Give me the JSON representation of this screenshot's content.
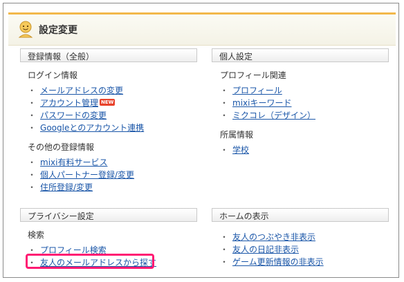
{
  "header": {
    "title": "設定変更"
  },
  "left_top": {
    "heading": "登録情報（全般）",
    "group1": {
      "title": "ログイン情報",
      "items": [
        "メールアドレスの変更",
        "アカウント管理",
        "パスワードの変更",
        "Googleとのアカウント連携"
      ],
      "new_badge": "NEW"
    },
    "group2": {
      "title": "その他の登録情報",
      "items": [
        "mixi有料サービス",
        "個人パートナー登録/変更",
        "住所登録/変更"
      ]
    }
  },
  "right_top": {
    "heading": "個人設定",
    "group1": {
      "title": "プロフィール関連",
      "items": [
        "プロフィール",
        "mixiキーワード",
        "ミクコレ（デザイン）"
      ]
    },
    "group2": {
      "title": "所属情報",
      "items": [
        "学校"
      ]
    }
  },
  "left_bottom": {
    "heading": "プライバシー設定",
    "group1": {
      "title": "検索",
      "items": [
        "プロフィール検索",
        "友人のメールアドレスから探す"
      ]
    }
  },
  "right_bottom": {
    "heading": "ホームの表示",
    "items": [
      "友人のつぶやき非表示",
      "友人の日記非表示",
      "ゲーム更新情報の非表示"
    ]
  },
  "bullet": "・",
  "colors": {
    "link": "#1a56a8",
    "accent": "#f2b84b",
    "highlight": "#ff1a73",
    "badge": "#e8422b"
  }
}
